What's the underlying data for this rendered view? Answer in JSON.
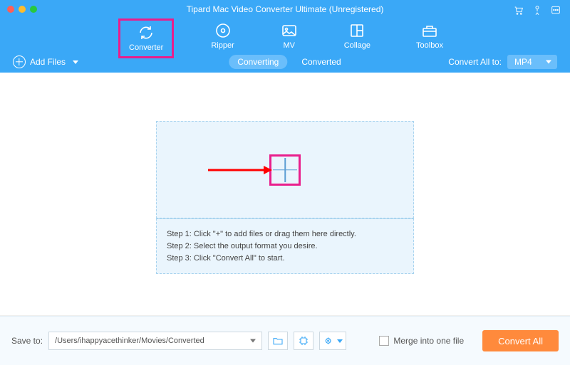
{
  "app": {
    "title": "Tipard Mac Video Converter Ultimate (Unregistered)"
  },
  "tabs": {
    "converter": "Converter",
    "ripper": "Ripper",
    "mv": "MV",
    "collage": "Collage",
    "toolbox": "Toolbox"
  },
  "toolbar": {
    "add_files": "Add Files",
    "converting": "Converting",
    "converted": "Converted",
    "convert_all_to": "Convert All to:",
    "format": "MP4"
  },
  "steps": {
    "s1": "Step 1: Click \"+\" to add files or drag them here directly.",
    "s2": "Step 2: Select the output format you desire.",
    "s3": "Step 3: Click \"Convert All\" to start."
  },
  "footer": {
    "save_to_label": "Save to:",
    "path": "/Users/ihappyacethinker/Movies/Converted",
    "merge_label": "Merge into one file",
    "convert_all": "Convert All"
  }
}
